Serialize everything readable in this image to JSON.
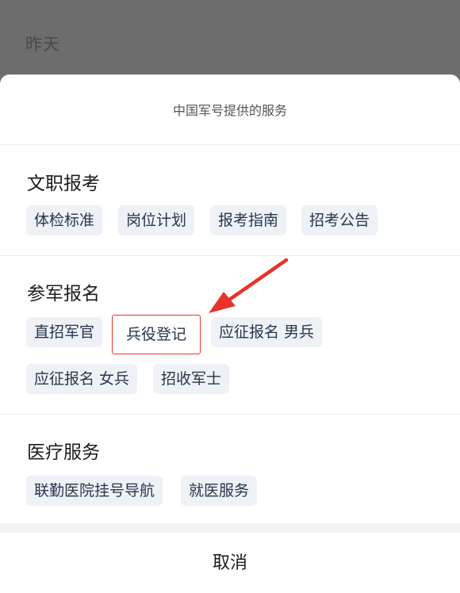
{
  "backdrop": {
    "text": "昨天"
  },
  "sheet": {
    "title": "中国军号提供的服务",
    "sections": [
      {
        "title": "文职报考",
        "items": [
          "体检标准",
          "岗位计划",
          "报考指南",
          "招考公告"
        ]
      },
      {
        "title": "参军报名",
        "items": [
          "直招军官",
          "兵役登记",
          "应征报名 男兵",
          "应征报名 女兵",
          "招收军士"
        ]
      },
      {
        "title": "医疗服务",
        "items": [
          "联勤医院挂号导航",
          "就医服务"
        ]
      }
    ],
    "cancel_label": "取消"
  },
  "annotation": {
    "highlighted_item": "兵役登记",
    "arrow_color": "#e8332a"
  },
  "colors": {
    "chip_bg": "#eef1f6",
    "chip_text": "#27364d",
    "highlight_border": "#e8332a"
  }
}
